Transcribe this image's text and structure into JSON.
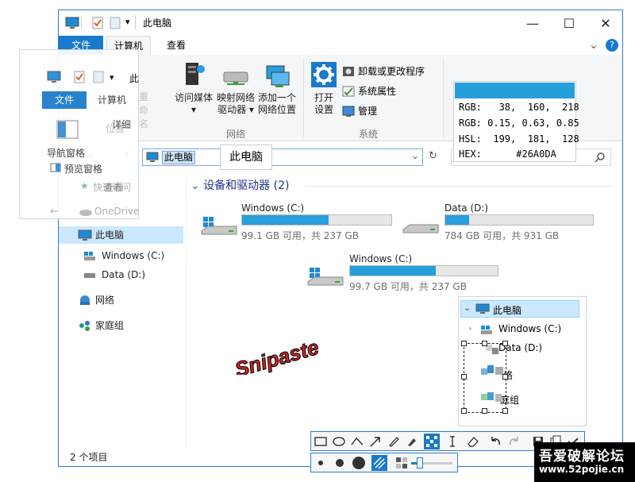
{
  "window": {
    "title": "此电脑",
    "tabs": [
      "文件",
      "计算机",
      "查看"
    ],
    "controls": {
      "minimize": "—",
      "maximize": "☐",
      "close": "✕"
    },
    "help": "?",
    "expand": "⌄"
  },
  "ribbon": {
    "group_network": {
      "label": "网络",
      "items": [
        {
          "label1": "访问媒体",
          "label2": "▾",
          "icon": "media-server-icon"
        },
        {
          "label1": "映射网络",
          "label2": "驱动器 ▾",
          "icon": "map-drive-icon"
        },
        {
          "label1": "添加一个",
          "label2": "网络位置",
          "icon": "add-network-location-icon"
        }
      ]
    },
    "group_system": {
      "label": "系统",
      "open_label1": "打开",
      "open_label2": "设置",
      "small_items": [
        {
          "label": "卸载或更改程序",
          "icon": "uninstall-icon"
        },
        {
          "label": "系统属性",
          "icon": "system-properties-icon"
        },
        {
          "label": "管理",
          "icon": "manage-icon"
        }
      ]
    }
  },
  "nav": {
    "back": "←",
    "forward": "→",
    "up": "↑",
    "address": "此电脑",
    "dropdown": "⌄",
    "refresh": "↻",
    "search_icon": "🔍"
  },
  "address_popup": "此电脑",
  "sidebar": {
    "items": [
      {
        "label": "此电脑",
        "selected": true,
        "icon": "this-pc-icon"
      },
      {
        "label": "Windows (C:)",
        "icon": "windows-drive-icon"
      },
      {
        "label": "Data (D:)",
        "icon": "drive-icon"
      },
      {
        "label": "网络",
        "icon": "network-icon"
      },
      {
        "label": "家庭组",
        "icon": "homegroup-icon"
      }
    ]
  },
  "content": {
    "section_title": "设备和驱动器 (2)",
    "drives": [
      {
        "name": "Windows (C:)",
        "info": "99.1 GB 可用，共 237 GB",
        "used_fraction": 0.58
      },
      {
        "name": "Data (D:)",
        "info": "784 GB 可用，共 931 GB",
        "used_fraction": 0.16
      },
      {
        "name": "Windows (C:)",
        "info": "99.7 GB 可用，共 237 GB",
        "used_fraction": 0.58
      }
    ]
  },
  "status_bar": "2 个项目",
  "color_picker": {
    "swatch": "#26A0DA",
    "rows": [
      "RGB:   38,  160,  218",
      "RGB: 0.15, 0.63, 0.85",
      "HSL:  199,  181,  128",
      "HEX:      #26A0DA"
    ]
  },
  "snip1": {
    "tabs": [
      "文件",
      "计算机"
    ],
    "title_partial": "此",
    "items": [
      {
        "label": "导航窗格"
      },
      {
        "label": "预览窗格"
      },
      {
        "label": "详细"
      },
      {
        "label": "快速访问"
      },
      {
        "label": "OneDrive"
      },
      {
        "label": "位置"
      },
      {
        "label": "重命名"
      },
      {
        "label": "查看"
      }
    ]
  },
  "snip2": {
    "items": [
      {
        "label": "此电脑"
      },
      {
        "label": "Windows (C:)"
      },
      {
        "label": "Data (D:)"
      },
      {
        "label": "络"
      },
      {
        "label": "庭组"
      }
    ]
  },
  "snipaste_label": "Snipaste",
  "toolbar": {
    "tools": [
      "rectangle-tool",
      "ellipse-tool",
      "polyline-tool",
      "arrow-tool",
      "pen-tool",
      "marker-tool",
      "mosaic-tool",
      "text-tool",
      "eraser-tool",
      "undo-tool",
      "redo-tool",
      "save-tool",
      "copy-tool",
      "done-tool"
    ],
    "sizes": [
      "small-dot",
      "medium-dot",
      "large-dot"
    ]
  },
  "watermark": {
    "line1": "吾爱破解论坛",
    "line2": "www.52pojie.cn"
  },
  "colors": {
    "accent": "#2b7bd6",
    "bar": "#26a0da",
    "red": "#e02020"
  }
}
